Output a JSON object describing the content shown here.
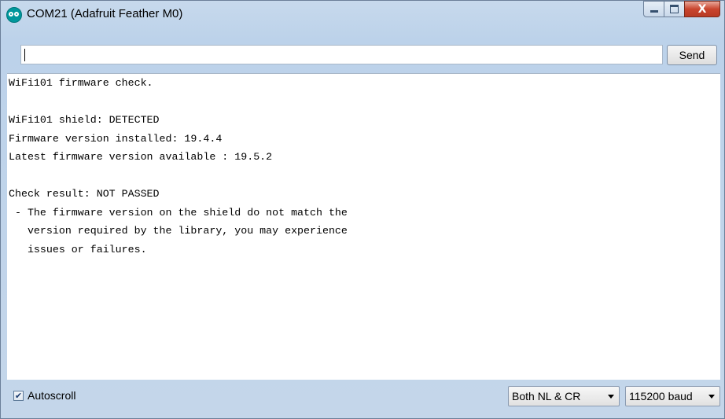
{
  "window": {
    "title": "COM21 (Adafruit Feather M0)",
    "icon": "arduino-icon",
    "controls": {
      "minimize": "minimize-icon",
      "maximize": "maximize-icon",
      "close": "X"
    }
  },
  "input": {
    "value": "",
    "placeholder": "",
    "send_label": "Send"
  },
  "output": {
    "lines": [
      "WiFi101 firmware check.",
      "",
      "WiFi101 shield: DETECTED",
      "Firmware version installed: 19.4.4",
      "Latest firmware version available : 19.5.2",
      "",
      "Check result: NOT PASSED",
      " - The firmware version on the shield do not match the",
      "   version required by the library, you may experience",
      "   issues or failures."
    ]
  },
  "status": {
    "autoscroll_label": "Autoscroll",
    "autoscroll_checked": true,
    "line_ending": "Both NL & CR",
    "baud_rate": "115200 baud"
  },
  "colors": {
    "close_button": "#c9452e",
    "arduino_teal": "#00979c"
  }
}
